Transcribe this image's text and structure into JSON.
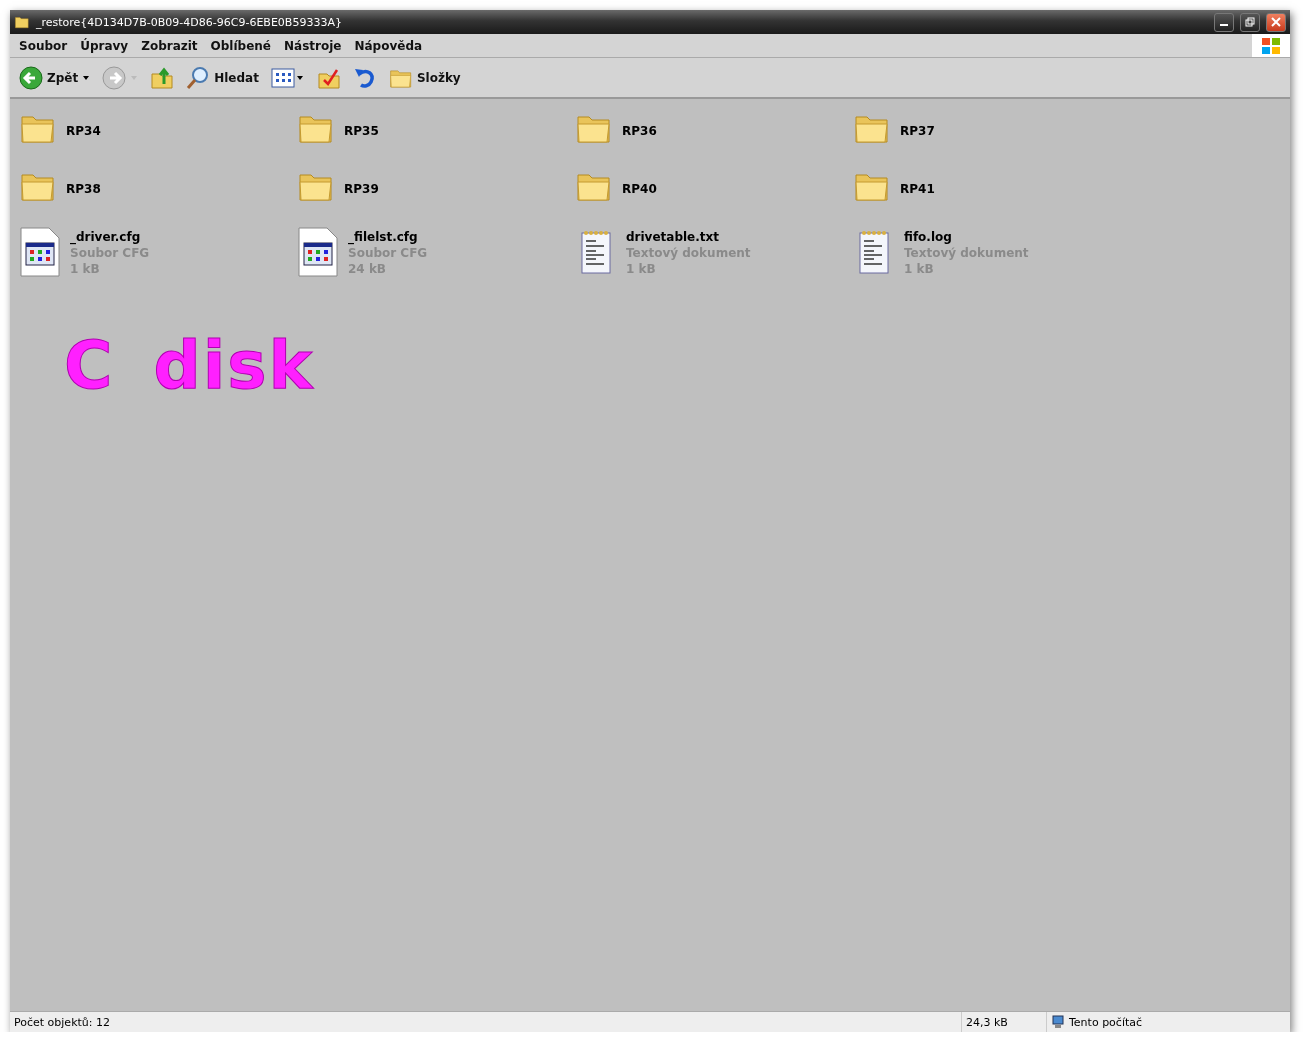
{
  "window": {
    "title": "_restore{4D134D7B-0B09-4D86-96C9-6EBE0B59333A}"
  },
  "menu": [
    "Soubor",
    "Úpravy",
    "Zobrazit",
    "Oblíbené",
    "Nástroje",
    "Nápověda"
  ],
  "toolbar": [
    {
      "kind": "back",
      "label": "Zpět",
      "disabled": false
    },
    {
      "kind": "forward",
      "disabled": true
    },
    {
      "kind": "up"
    },
    {
      "kind": "search",
      "label": "Hledat"
    },
    {
      "kind": "views"
    },
    {
      "kind": "check"
    },
    {
      "kind": "undo"
    },
    {
      "kind": "folders",
      "label": "Složky"
    }
  ],
  "items": [
    {
      "kind": "folder",
      "name": "RP34"
    },
    {
      "kind": "folder",
      "name": "RP35"
    },
    {
      "kind": "folder",
      "name": "RP36"
    },
    {
      "kind": "folder",
      "name": "RP37"
    },
    {
      "kind": "folder",
      "name": "RP38"
    },
    {
      "kind": "folder",
      "name": "RP39"
    },
    {
      "kind": "folder",
      "name": "RP40"
    },
    {
      "kind": "folder",
      "name": "RP41"
    },
    {
      "kind": "cfg",
      "name": "_driver.cfg",
      "type": "Soubor CFG",
      "size": "1 kB"
    },
    {
      "kind": "cfg",
      "name": "_filelst.cfg",
      "type": "Soubor CFG",
      "size": "24 kB"
    },
    {
      "kind": "text",
      "name": "drivetable.txt",
      "type": "Textový dokument",
      "size": "1 kB"
    },
    {
      "kind": "text",
      "name": "fifo.log",
      "type": "Textový dokument",
      "size": "1 kB"
    }
  ],
  "overlay_text": "C disk",
  "status_bar": {
    "count": "Počet objektů: 12",
    "size": "24,3 kB",
    "location": "Tento počítač"
  }
}
